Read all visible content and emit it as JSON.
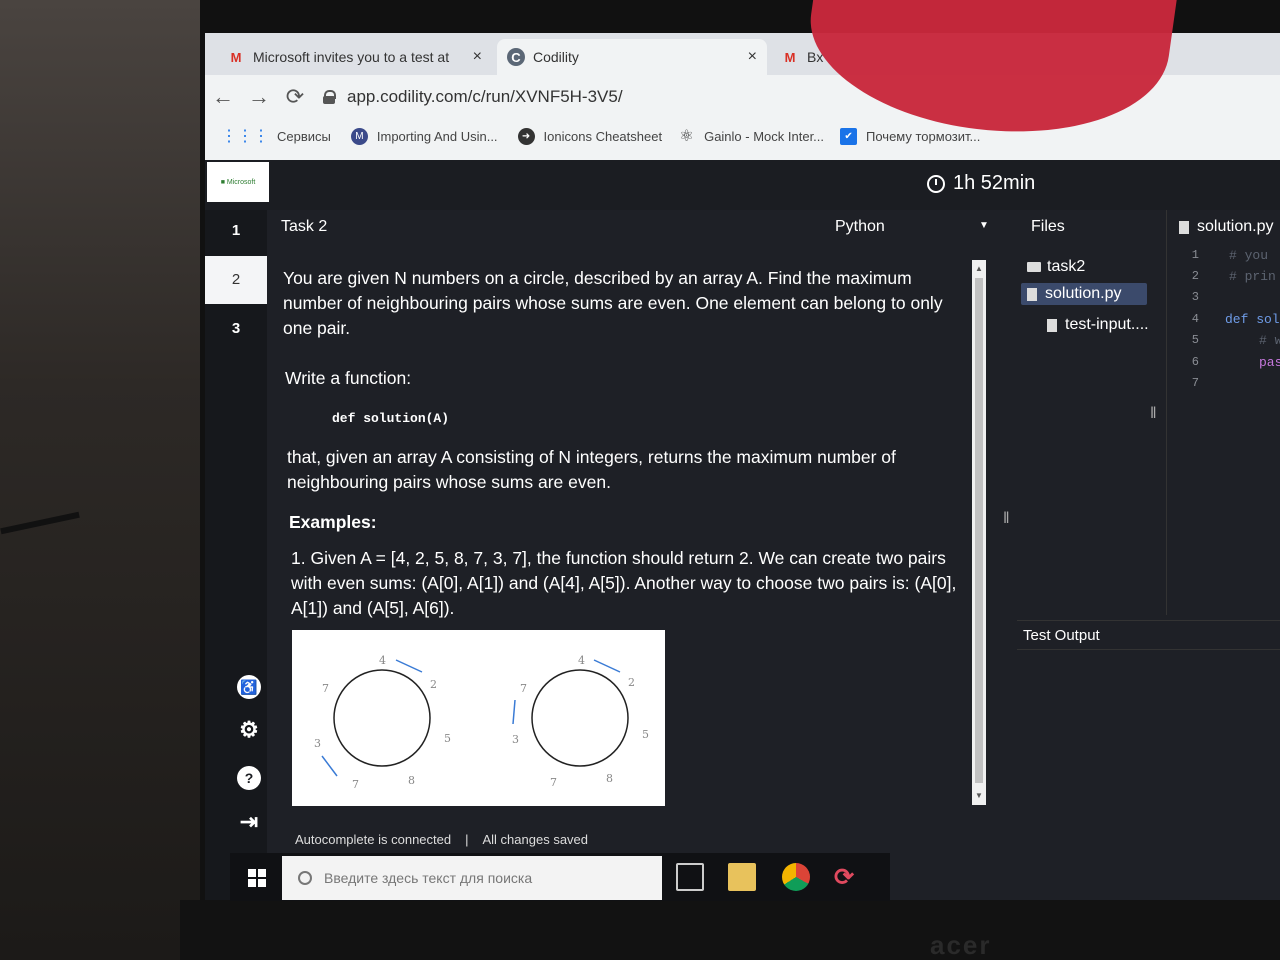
{
  "browser": {
    "tabs": [
      {
        "label": "Microsoft invites you to a test at",
        "close": "×",
        "icon": "gmail-icon"
      },
      {
        "label": "Codility",
        "close": "×",
        "icon": "codility-icon"
      },
      {
        "label": "Bx",
        "icon": "gmail-icon"
      }
    ],
    "nav": {
      "back": "←",
      "forward": "→",
      "reload": "⟳"
    },
    "url": "app.codility.com/c/run/XVNF5H-3V5/",
    "bookmarks": [
      {
        "label": "Сервисы"
      },
      {
        "label": "Importing And Usin..."
      },
      {
        "label": "Ionicons Cheatsheet"
      },
      {
        "label": "Gainlo - Mock Inter..."
      },
      {
        "label": "Почему тормозит..."
      }
    ]
  },
  "app": {
    "timer": "1h 52min",
    "sidebar": {
      "tasks": [
        "1",
        "2",
        "3"
      ]
    },
    "task": {
      "title": "Task 2",
      "language": "Python",
      "paragraphs": {
        "intro": "You are given N numbers on a circle, described by an array A. Find the maximum number of neighbouring pairs whose sums are even. One element can belong to only one pair.",
        "write": "Write a function:",
        "signature": "def solution(A)",
        "that": "that, given an array A consisting of N integers, returns the maximum number of neighbouring pairs whose sums are even.",
        "examples_heading": "Examples:",
        "example1": "1. Given A = [4, 2, 5, 8, 7, 3, 7], the function should return 2. We can create two pairs with even sums: (A[0], A[1]) and (A[4], A[5]). Another way to choose two pairs is: (A[0], A[1]) and (A[5], A[6])."
      },
      "figure": {
        "left_circle_labels": [
          "4",
          "2",
          "5",
          "8",
          "7",
          "3",
          "7"
        ],
        "right_circle_labels": [
          "4",
          "2",
          "5",
          "8",
          "7",
          "3",
          "7"
        ]
      }
    },
    "files": {
      "title": "Files",
      "folder": "task2",
      "items": [
        "solution.py",
        "test-input...."
      ]
    },
    "editor": {
      "tab": "solution.py",
      "line_numbers": [
        "1",
        "2",
        "3",
        "4",
        "5",
        "6",
        "7"
      ],
      "lines": [
        "# you",
        "# prin",
        "",
        "def sol",
        "# w",
        "pas",
        ""
      ]
    },
    "test_output": "Test Output",
    "status": {
      "autocomplete": "Autocomplete is connected",
      "separator": "|",
      "saved": "All changes saved"
    }
  },
  "taskbar": {
    "search_placeholder": "Введите здесь текст для поиска"
  }
}
